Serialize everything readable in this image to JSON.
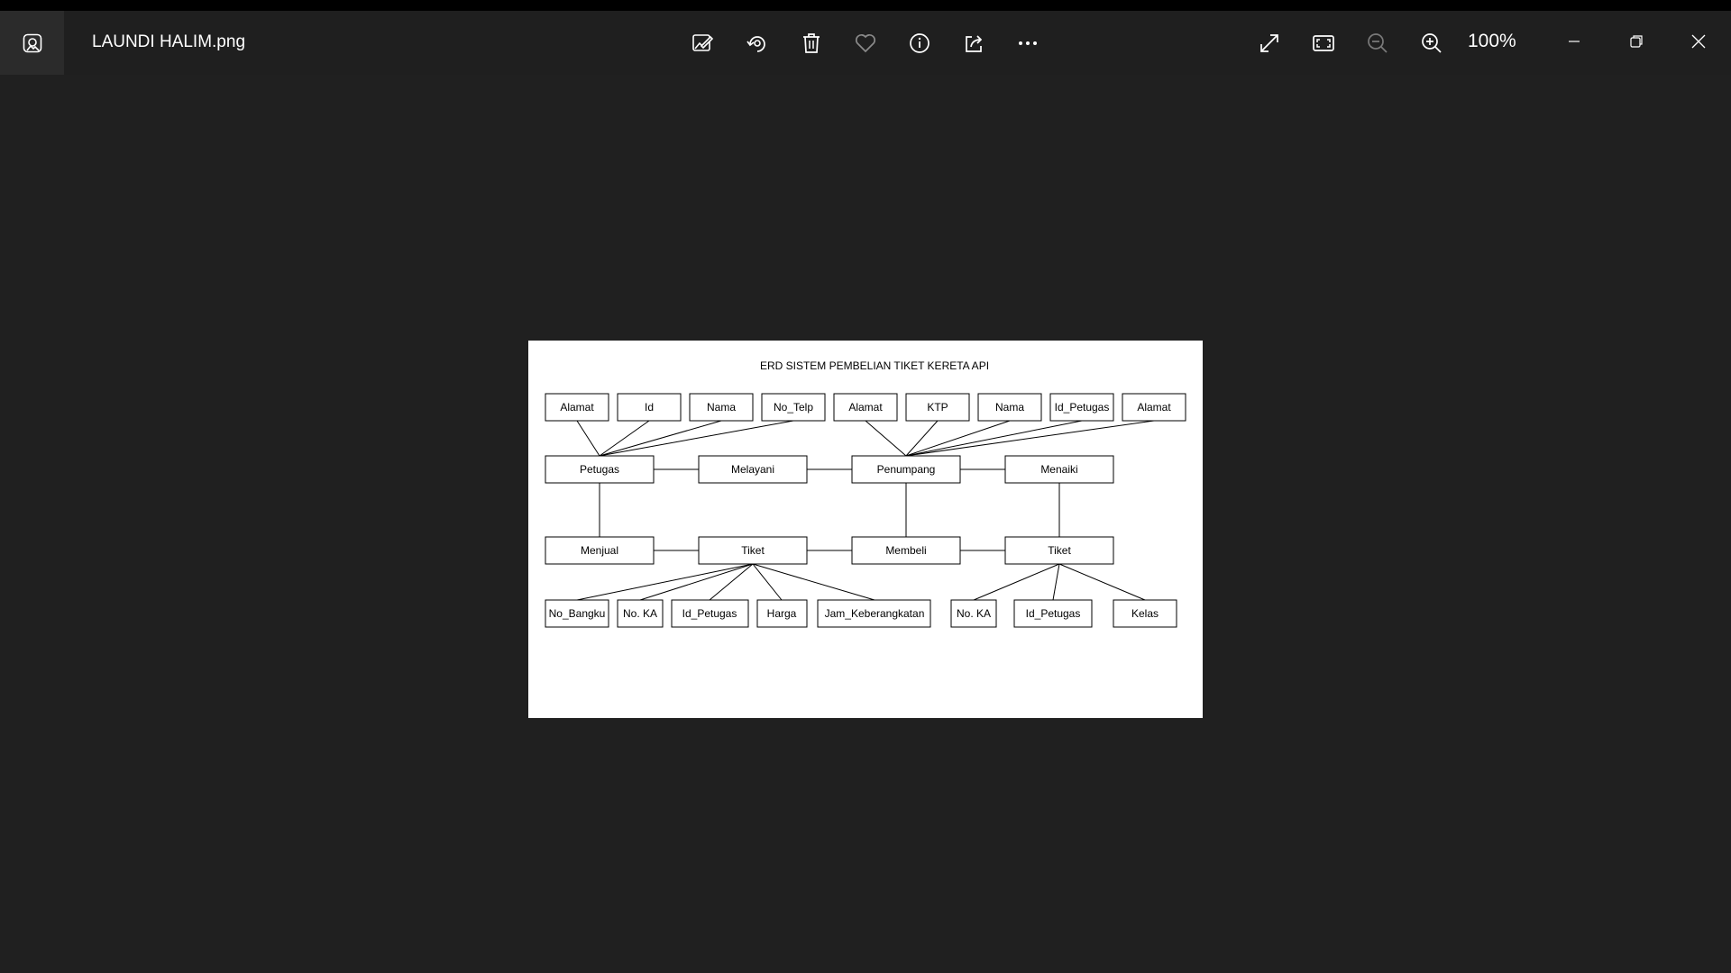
{
  "window": {
    "file_name": "LAUNDI HALIM.png",
    "zoom": "100%"
  },
  "toolbar": {
    "buttons": [
      {
        "icon": "edit-image-icon"
      },
      {
        "icon": "rotate-icon"
      },
      {
        "icon": "delete-icon"
      },
      {
        "icon": "favorite-heart-icon"
      },
      {
        "icon": "info-icon"
      },
      {
        "icon": "share-icon"
      },
      {
        "icon": "more-icon"
      }
    ],
    "view_buttons": [
      {
        "icon": "full-screen-icon"
      },
      {
        "icon": "fit-to-window-icon"
      },
      {
        "icon": "zoom-out-icon"
      },
      {
        "icon": "zoom-in-icon"
      }
    ]
  },
  "colors": {
    "background": "#202020",
    "toolbar": "#1f1f1f",
    "app_icon_box": "#2b2b2b",
    "text": "#ffffff"
  },
  "diagram": {
    "title": "ERD SISTEM PEMBELIAN TIKET KERETA API",
    "top_attributes": [
      "Alamat",
      "Id",
      "Nama",
      "No_Telp",
      "Alamat",
      "KTP",
      "Nama",
      "Id_Petugas",
      "Alamat"
    ],
    "entities": {
      "petugas": "Petugas",
      "melayani": "Melayani",
      "penumpang": "Penumpang",
      "menaiki": "Menaiki",
      "menjual": "Menjual",
      "tiket_1": "Tiket",
      "membeli": "Membeli",
      "tiket_2": "Tiket"
    },
    "bottom_attributes": [
      "No_Bangku",
      "No. KA",
      "Id_Petugas",
      "Harga",
      "Jam_Keberangkatan",
      "No. KA",
      "Id_Petugas",
      "Kelas"
    ]
  }
}
